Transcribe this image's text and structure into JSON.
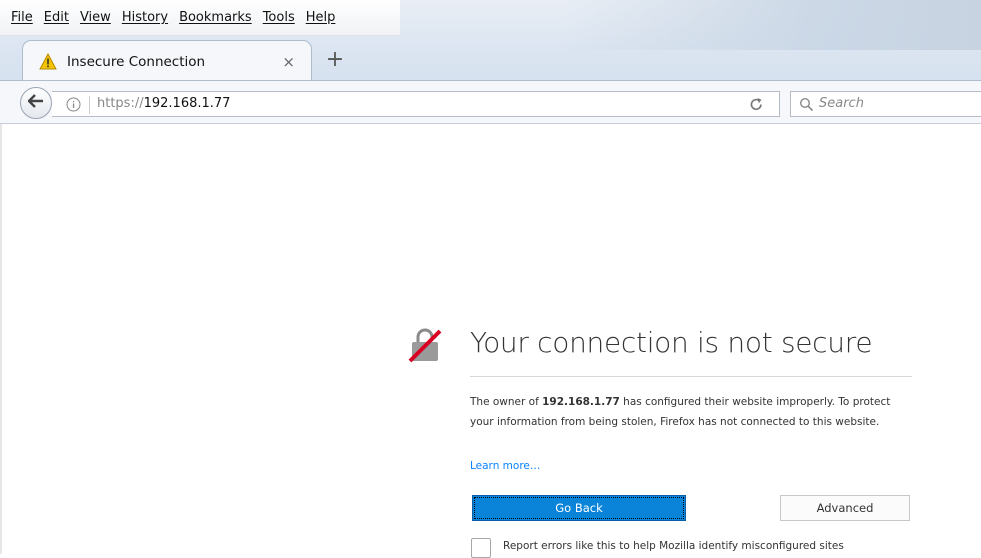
{
  "menubar": {
    "items": [
      "File",
      "Edit",
      "View",
      "History",
      "Bookmarks",
      "Tools",
      "Help"
    ]
  },
  "tab": {
    "title": "Insecure Connection",
    "close": "×",
    "new_tab": "+"
  },
  "navbar": {
    "url_prefix": "https://",
    "url_host": "192.168.1.77",
    "search_placeholder": "Search"
  },
  "error": {
    "title": "Your connection is not secure",
    "desc_before": "The owner of ",
    "desc_host": "192.168.1.77",
    "desc_after": " has configured their website improperly. To protect your information from being stolen, Firefox has not connected to this website.",
    "learn_more": "Learn more…",
    "go_back": "Go Back",
    "advanced": "Advanced",
    "report_label": "Report errors like this to help Mozilla identify misconfigured sites"
  },
  "colors": {
    "primary_button": "#0a84d9",
    "link": "#0a84ff",
    "warning": "#f5c400"
  },
  "icons": [
    "warning-icon",
    "back-arrow-icon",
    "info-icon",
    "reload-icon",
    "search-icon",
    "broken-lock-icon"
  ]
}
